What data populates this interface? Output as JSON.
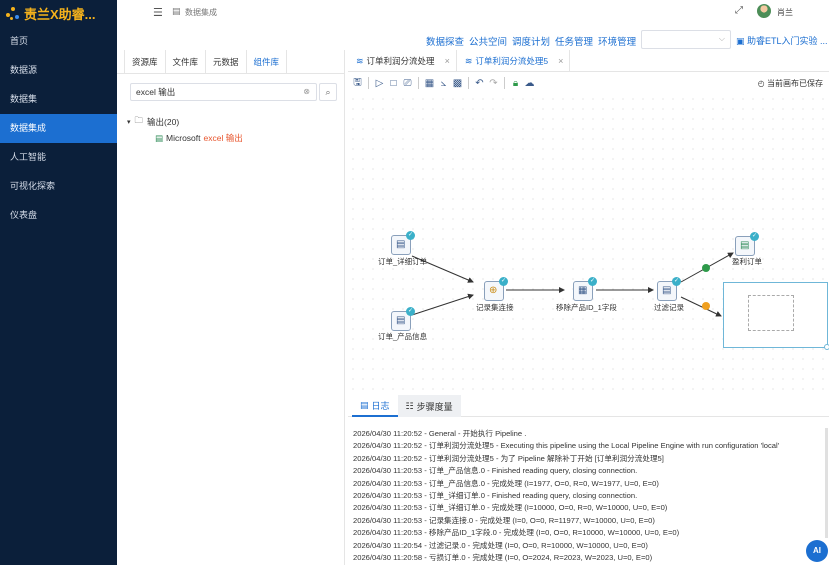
{
  "app": {
    "title": "责兰X助睿..."
  },
  "sidebar": {
    "items": [
      {
        "label": "首页",
        "active": false
      },
      {
        "label": "数据源",
        "active": false
      },
      {
        "label": "数据集",
        "active": false
      },
      {
        "label": "数据集成",
        "active": true
      },
      {
        "label": "人工智能",
        "active": false
      },
      {
        "label": "可视化探索",
        "active": false
      },
      {
        "label": "仪表盘",
        "active": false
      }
    ]
  },
  "topbar": {
    "breadcrumb": "数据集成",
    "username": "肖兰"
  },
  "appmenu": {
    "links": [
      "数据探查",
      "公共空间",
      "调度计划",
      "任务管理",
      "环境管理"
    ],
    "select_value": "",
    "guide": "助睿ETL入门实验 ..."
  },
  "leftpanel": {
    "tabs": [
      {
        "label": "资源库",
        "active": false
      },
      {
        "label": "文件库",
        "active": false
      },
      {
        "label": "元数据",
        "active": false
      },
      {
        "label": "组件库",
        "active": true
      }
    ],
    "search_value": "excel 输出",
    "tree": {
      "root": "输出(20)",
      "child_prefix": "Microsoft ",
      "child_highlight": "excel 输出"
    }
  },
  "editor": {
    "tabs": [
      {
        "label": "订单利润分流处理",
        "active": false
      },
      {
        "label": "订单利润分流处理5",
        "active": true
      }
    ],
    "saved_text": "当前画布已保存"
  },
  "canvas": {
    "nodes": [
      {
        "id": "n1",
        "label": "订单_详细订单"
      },
      {
        "id": "n2",
        "label": "订单_产品信息"
      },
      {
        "id": "n3",
        "label": "记录集连接"
      },
      {
        "id": "n4",
        "label": "移除产品ID_1字段"
      },
      {
        "id": "n5",
        "label": "过滤记录"
      },
      {
        "id": "n6",
        "label": "盈利订单"
      }
    ]
  },
  "log": {
    "tabs": [
      {
        "label": "日志",
        "active": true
      },
      {
        "label": "步骤度量",
        "active": false
      }
    ],
    "lines": [
      "2026/04/30 11:20:52 - General - 开始执行 Pipeline .",
      "2026/04/30 11:20:52 - 订单利润分流处理5 - Executing this pipeline using the Local Pipeline Engine with run configuration 'local'",
      "2026/04/30 11:20:52 - 订单利润分流处理5 - 为了 Pipeline 解除补丁开始 [订单利润分流处理5]",
      "2026/04/30 11:20:53 - 订单_产品信息.0 - Finished reading query, closing connection.",
      "2026/04/30 11:20:53 - 订单_产品信息.0 - 完成处理 (I=1977, O=0, R=0, W=1977, U=0, E=0)",
      "2026/04/30 11:20:53 - 订单_详细订单.0 - Finished reading query, closing connection.",
      "2026/04/30 11:20:53 - 订单_详细订单.0 - 完成处理 (I=10000, O=0, R=0, W=10000, U=0, E=0)",
      "2026/04/30 11:20:53 - 记录集连接.0 - 完成处理 (I=0, O=0, R=11977, W=10000, U=0, E=0)",
      "2026/04/30 11:20:53 - 移除产品ID_1字段.0 - 完成处理 (I=0, O=0, R=10000, W=10000, U=0, E=0)",
      "2026/04/30 11:20:54 - 过滤记录.0 - 完成处理 (I=0, O=0, R=10000, W=10000, U=0, E=0)",
      "2026/04/30 11:20:58 - 亏损订单.0 - 完成处理 (I=0, O=2024, R=2023, W=2023, U=0, E=0)"
    ]
  },
  "ai_button": "AI"
}
